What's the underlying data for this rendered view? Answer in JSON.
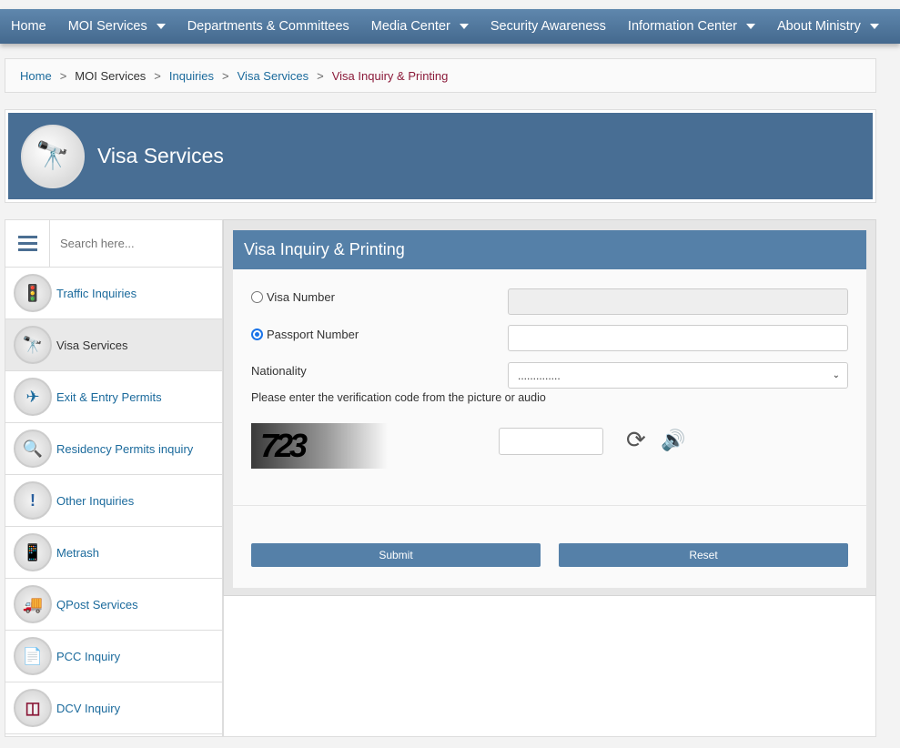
{
  "nav": {
    "items": [
      {
        "label": "Home",
        "dropdown": false
      },
      {
        "label": "MOI Services",
        "dropdown": true
      },
      {
        "label": "Departments & Committees",
        "dropdown": false
      },
      {
        "label": "Media Center",
        "dropdown": true
      },
      {
        "label": "Security Awareness",
        "dropdown": false
      },
      {
        "label": "Information Center",
        "dropdown": true
      },
      {
        "label": "About Ministry",
        "dropdown": true
      }
    ]
  },
  "breadcrumb": {
    "items": [
      "Home",
      "MOI Services",
      "Inquiries",
      "Visa Services",
      "Visa Inquiry & Printing"
    ],
    "separator": ">"
  },
  "banner": {
    "title": "Visa Services",
    "icon": "binoculars-icon"
  },
  "sidebar": {
    "search_placeholder": "Search here...",
    "items": [
      {
        "label": "Traffic Inquiries",
        "icon": "traffic-light-icon"
      },
      {
        "label": "Visa Services",
        "icon": "binoculars-icon",
        "active": true
      },
      {
        "label": "Exit & Entry Permits",
        "icon": "airplane-icon"
      },
      {
        "label": "Residency Permits inquiry",
        "icon": "magnifier-icon"
      },
      {
        "label": "Other Inquiries",
        "icon": "exclamation-icon"
      },
      {
        "label": "Metrash",
        "icon": "phone-icon"
      },
      {
        "label": "QPost Services",
        "icon": "truck-icon"
      },
      {
        "label": "PCC Inquiry",
        "icon": "certificate-icon"
      },
      {
        "label": "DCV Inquiry",
        "icon": "document-icon"
      }
    ]
  },
  "form": {
    "title": "Visa Inquiry & Printing",
    "visa_number_label": "Visa Number",
    "passport_number_label": "Passport Number",
    "selected_option": "Passport Number",
    "nationality_label": "Nationality",
    "nationality_value": "..............",
    "verification_text": "Please enter the verification code from the picture or audio",
    "captcha_text": "723",
    "submit_label": "Submit",
    "reset_label": "Reset"
  },
  "colors": {
    "nav": "#4b6e90",
    "header": "#5580a8",
    "link": "#1b6a9c",
    "current": "#8b1b3a"
  }
}
